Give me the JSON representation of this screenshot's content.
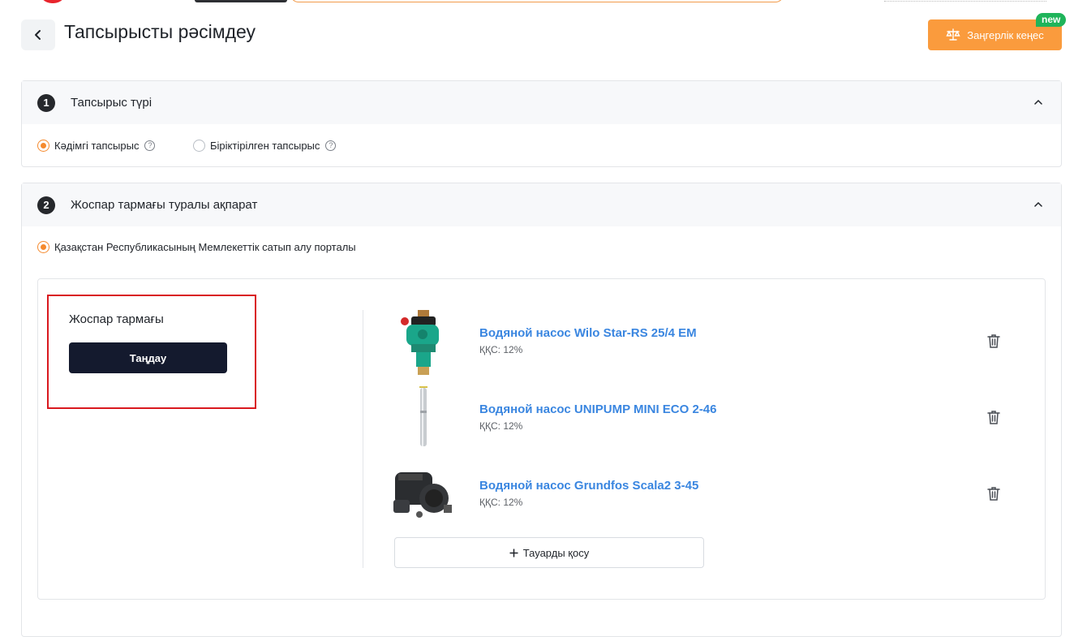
{
  "page": {
    "title": "Тапсырысты рәсімдеу"
  },
  "legal_consult": {
    "label": "Заңгерлік кеңес",
    "badge": "new"
  },
  "section_order_type": {
    "step": "1",
    "title": "Тапсырыс түрі",
    "options": [
      {
        "label": "Кәдімгі тапсырыс",
        "selected": true
      },
      {
        "label": "Біріктірілген тапсырыс",
        "selected": false
      }
    ]
  },
  "section_plan": {
    "step": "2",
    "title": "Жоспар тармағы туралы ақпарат",
    "portal_option": {
      "label": "Қазақстан Республикасының Мемлекеттік сатып алу порталы",
      "selected": true
    },
    "branch_label": "Жоспар тармағы",
    "choose_label": "Таңдау",
    "products": [
      {
        "name": "Водяной насос Wilo Star-RS 25/4 EM",
        "vat": "ҚҚС: 12%"
      },
      {
        "name": "Водяной насос UNIPUMP MINI ECO 2-46",
        "vat": "ҚҚС: 12%"
      },
      {
        "name": "Водяной насос Grundfos Scala2 3-45",
        "vat": "ҚҚС: 12%"
      }
    ],
    "add_label": "Тауарды қосу"
  },
  "colors": {
    "accent": "#fa9b3d",
    "radio": "#f58a2e",
    "link": "#3a86e0",
    "primary_btn": "#141a2e",
    "highlight": "#d9191f",
    "badge": "#1fb45a"
  },
  "icons": [
    "back-arrow-icon",
    "scales-icon",
    "chevron-up-icon",
    "help-icon",
    "trash-icon",
    "plus-icon"
  ]
}
